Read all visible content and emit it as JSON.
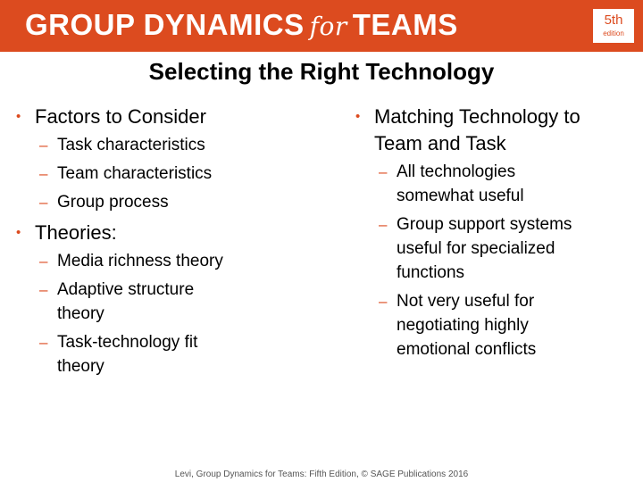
{
  "header": {
    "title_part1": "GROUP DYNAMICS",
    "title_for": "for",
    "title_part2": "TEAMS",
    "edition_number": "5th",
    "edition_word": "edition",
    "brand_color": "#dc4b1f"
  },
  "slide": {
    "title": "Selecting the Right Technology",
    "left_column": [
      {
        "text": "Factors to Consider",
        "subitems": [
          "Task characteristics",
          "Team characteristics",
          "Group process"
        ]
      },
      {
        "text": "Theories:",
        "subitems": [
          "Media richness theory",
          "Adaptive structure theory",
          "Task-technology fit theory"
        ]
      }
    ],
    "right_column": [
      {
        "text": "Matching Technology to Team and Task",
        "subitems": [
          "All technologies somewhat useful",
          "Group support systems useful for specialized functions",
          "Not very useful for negotiating highly emotional conflicts"
        ]
      }
    ]
  },
  "footer": {
    "text": "Levi, Group Dynamics for Teams: Fifth Edition, © SAGE Publications 2016"
  }
}
